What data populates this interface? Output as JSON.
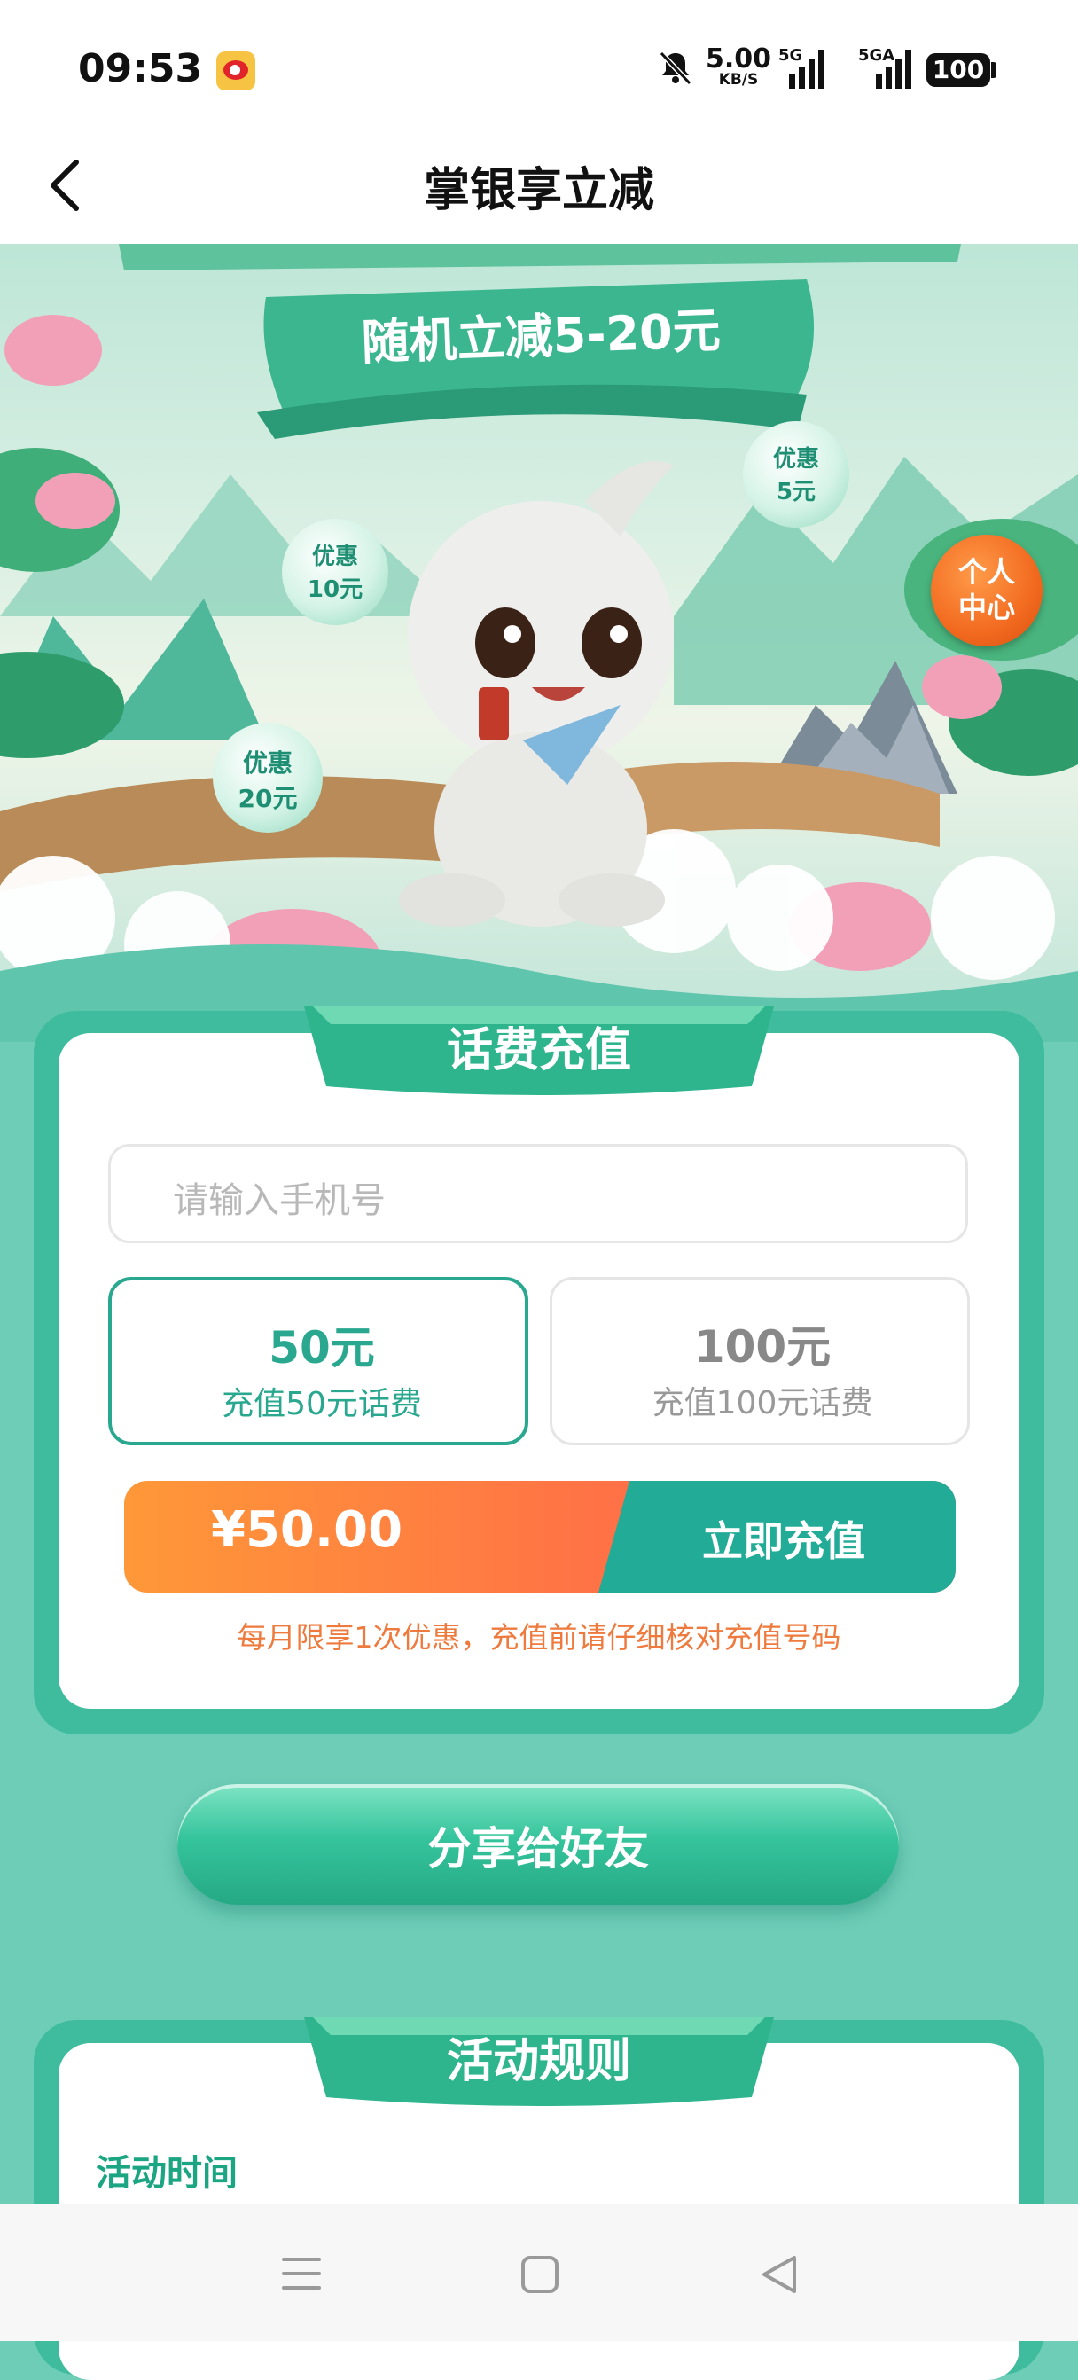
{
  "status_bar": {
    "time": "09:53",
    "net_speed_value": "5.00",
    "net_speed_unit": "KB/S",
    "sim1": "5G",
    "sim2": "5GA",
    "battery": "100"
  },
  "header": {
    "title": "掌银享立减"
  },
  "hero": {
    "banner_text": "随机立减5-20元",
    "bubbles": [
      {
        "label": "优惠",
        "amount": "10元"
      },
      {
        "label": "优惠",
        "amount": "5元"
      },
      {
        "label": "优惠",
        "amount": "20元"
      }
    ],
    "personal_center": "个人\n中心"
  },
  "recharge": {
    "section_title": "话费充值",
    "phone_placeholder": "请输入手机号",
    "options": [
      {
        "main": "50元",
        "sub": "充值50元话费",
        "selected": true
      },
      {
        "main": "100元",
        "sub": "充值100元话费",
        "selected": false
      }
    ],
    "price": "¥50.00",
    "pay_button": "立即充值",
    "notice": "每月限享1次优惠，充值前请仔细核对充值号码"
  },
  "share_button": "分享给好友",
  "rules": {
    "section_title": "活动规则",
    "time_heading": "活动时间"
  },
  "colors": {
    "page_bg": "#6dcdb7",
    "accent_green": "#2aa88f",
    "orange": "#ff8c35",
    "red": "#ff5a4e",
    "notice": "#ef7a3d"
  },
  "nav": {
    "icons": [
      "menu-icon",
      "home-icon",
      "back-icon"
    ]
  }
}
